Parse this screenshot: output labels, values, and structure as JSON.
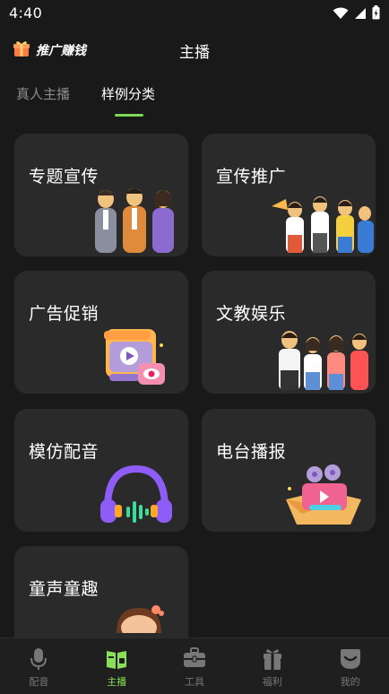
{
  "status": {
    "time": "4:40"
  },
  "header": {
    "promo_label": "推广赚钱",
    "title": "主播"
  },
  "tabs": [
    {
      "label": "真人主播",
      "active": false
    },
    {
      "label": "样例分类",
      "active": true
    }
  ],
  "categories": [
    {
      "title": "专题宣传",
      "icon": "business-team-icon"
    },
    {
      "title": "宣传推广",
      "icon": "cheering-group-icon"
    },
    {
      "title": "广告促销",
      "icon": "video-ad-icon"
    },
    {
      "title": "文教娱乐",
      "icon": "school-kids-icon"
    },
    {
      "title": "模仿配音",
      "icon": "headphones-icon"
    },
    {
      "title": "电台播报",
      "icon": "film-reel-box-icon"
    },
    {
      "title": "童声童趣",
      "icon": "child-icon"
    }
  ],
  "bottom_nav": [
    {
      "label": "配音",
      "icon": "microphone-icon",
      "active": false
    },
    {
      "label": "主播",
      "icon": "anchor-book-icon",
      "active": true
    },
    {
      "label": "工具",
      "icon": "toolbox-icon",
      "active": false
    },
    {
      "label": "福利",
      "icon": "gift-icon",
      "active": false
    },
    {
      "label": "我的",
      "icon": "profile-icon",
      "active": false
    }
  ],
  "colors": {
    "accent": "#8be05a",
    "background": "#191919",
    "card": "#2a2a2a"
  }
}
